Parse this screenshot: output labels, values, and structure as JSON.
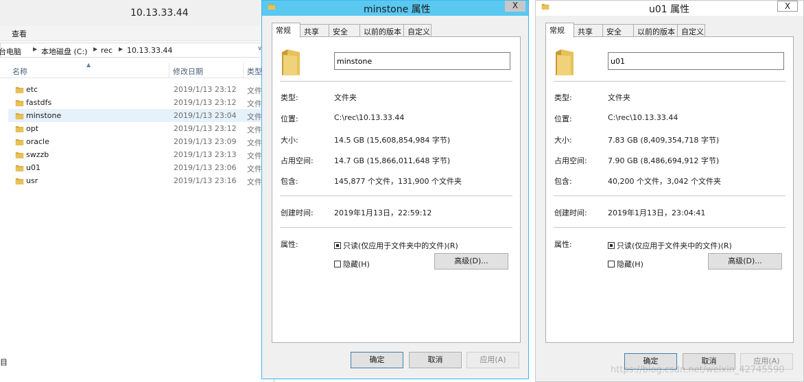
{
  "explorer": {
    "title": "10.13.33.44",
    "menu_view": "查看",
    "breadcrumb": [
      "台电脑",
      "本地磁盘 (C:)",
      "rec",
      "10.13.33.44"
    ],
    "columns": {
      "name": "名称",
      "date": "修改日期",
      "type": "类型"
    },
    "rows": [
      {
        "name": "etc",
        "date": "2019/1/13 23:12",
        "type": "文件"
      },
      {
        "name": "fastdfs",
        "date": "2019/1/13 23:12",
        "type": "文件"
      },
      {
        "name": "minstone",
        "date": "2019/1/13 23:04",
        "type": "文件"
      },
      {
        "name": "opt",
        "date": "2019/1/13 23:12",
        "type": "文件"
      },
      {
        "name": "oracle",
        "date": "2019/1/13 23:09",
        "type": "文件"
      },
      {
        "name": "swzzb",
        "date": "2019/1/13 23:13",
        "type": "文件"
      },
      {
        "name": "u01",
        "date": "2019/1/13 23:06",
        "type": "文件"
      },
      {
        "name": "usr",
        "date": "2019/1/13 23:16",
        "type": "文件"
      }
    ],
    "selected_row": "minstone",
    "left_strip": "目"
  },
  "tabs": [
    "常规",
    "共享",
    "安全",
    "以前的版本",
    "自定义"
  ],
  "labels": {
    "type": "类型:",
    "location": "位置:",
    "size": "大小:",
    "size_on_disk": "占用空间:",
    "contains": "包含:",
    "created": "创建时间:",
    "attributes": "属性:",
    "readonly": "只读(仅应用于文件夹中的文件)(R)",
    "hidden": "隐藏(H)",
    "advanced": "高级(D)...",
    "ok": "确定",
    "cancel": "取消",
    "apply": "应用(A)",
    "close_glyph": "X"
  },
  "dialogs": [
    {
      "title": "minstone 属性",
      "name": "minstone",
      "type": "文件夹",
      "location": "C:\\rec\\10.13.33.44",
      "size": "14.5 GB (15,608,854,984 字节)",
      "size_on_disk": "14.7 GB (15,866,011,648 字节)",
      "contains": "145,877 个文件，131,900 个文件夹",
      "created": "2019年1月13日，22:59:12",
      "readonly_checked": true,
      "hidden_checked": false
    },
    {
      "title": "u01 属性",
      "name": "u01",
      "type": "文件夹",
      "location": "C:\\rec\\10.13.33.44",
      "size": "7.83 GB (8,409,354,718 字节)",
      "size_on_disk": "7.90 GB (8,486,694,912 字节)",
      "contains": "40,200 个文件，3,042 个文件夹",
      "created": "2019年1月13日，23:04:41",
      "readonly_checked": true,
      "hidden_checked": false
    }
  ],
  "watermark": "https://blog.csdn.net/weixin_42745590",
  "colors": {
    "folder": "#e8c15a",
    "active_title": "#5ac8f1",
    "selection": "#e5f1fb"
  }
}
